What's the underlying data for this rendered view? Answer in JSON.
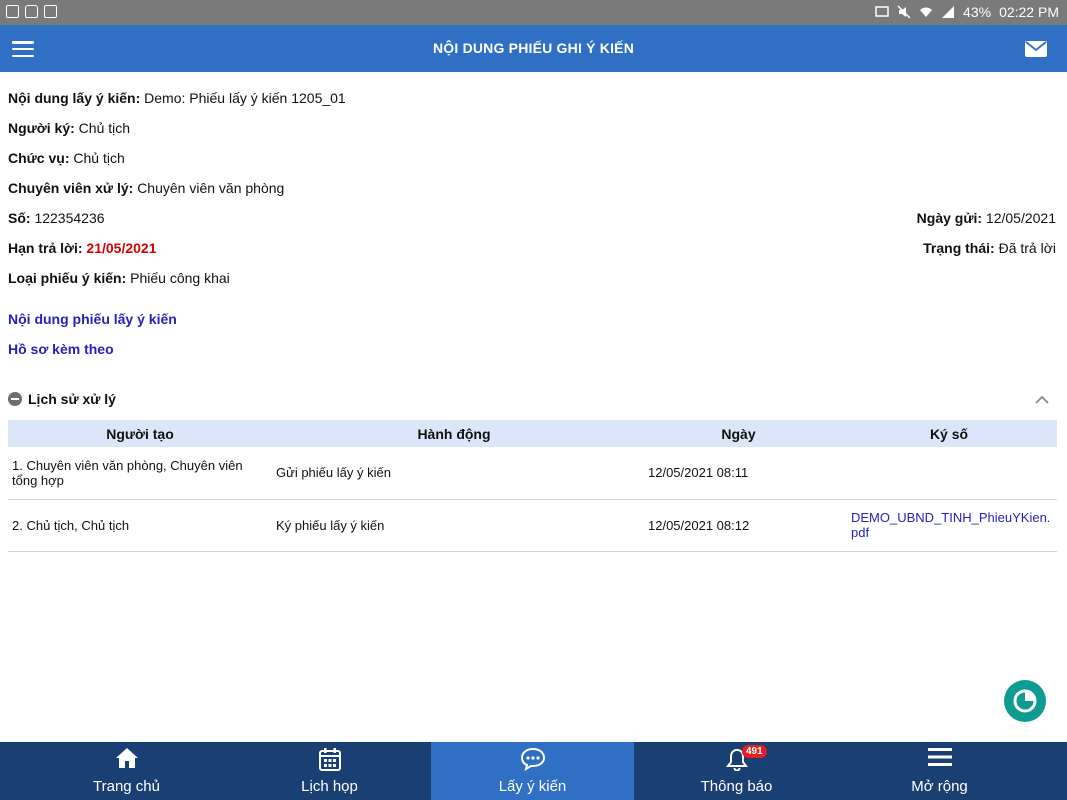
{
  "status_bar": {
    "battery": "43%",
    "time": "02:22 PM"
  },
  "header": {
    "title": "NỘI DUNG PHIẾU GHI Ý KIẾN"
  },
  "info": {
    "noi_dung_label": "Nội dung lấy ý kiến:",
    "noi_dung_value": "Demo: Phiếu lấy ý kiến 1205_01",
    "nguoi_ky_label": "Người ký:",
    "nguoi_ky_value": "Chủ tịch",
    "chuc_vu_label": "Chức vụ:",
    "chuc_vu_value": "Chủ tịch",
    "chuyen_vien_label": "Chuyên viên xử lý:",
    "chuyen_vien_value": "Chuyên viên văn phòng",
    "so_label": "Số:",
    "so_value": "122354236",
    "ngay_gui_label": "Ngày gửi:",
    "ngay_gui_value": "12/05/2021",
    "han_tra_loi_label": "Hạn trả lời:",
    "han_tra_loi_value": "21/05/2021",
    "trang_thai_label": "Trạng thái:",
    "trang_thai_value": "Đã trả lời",
    "loai_phieu_label": "Loại phiếu ý kiến:",
    "loai_phieu_value": "Phiếu công khai"
  },
  "links": {
    "noi_dung_phieu": "Nội dung phiếu lấy ý kiến",
    "ho_so": "Hồ sơ kèm theo"
  },
  "history": {
    "title": "Lịch sử xử lý",
    "columns": [
      "Người tạo",
      "Hành động",
      "Ngày",
      "Ký số"
    ],
    "rows": [
      {
        "nguoi_tao": "1. Chuyên viên văn phòng, Chuyên viên tổng hợp",
        "hanh_dong": "Gửi phiếu lấy ý kiến",
        "ngay": "12/05/2021 08:11",
        "ky_so": ""
      },
      {
        "nguoi_tao": "2. Chủ tịch, Chủ tịch",
        "hanh_dong": "Ký phiếu lấy ý kiến",
        "ngay": "12/05/2021 08:12",
        "ky_so": "DEMO_UBND_TINH_PhieuYKien.pdf"
      }
    ]
  },
  "bottom_nav": {
    "items": [
      {
        "label": "Trang chủ",
        "icon": "home-icon"
      },
      {
        "label": "Lịch họp",
        "icon": "calendar-icon"
      },
      {
        "label": "Lấy ý kiến",
        "icon": "chat-icon"
      },
      {
        "label": "Thông báo",
        "icon": "bell-icon",
        "badge": "491"
      },
      {
        "label": "Mở rộng",
        "icon": "menu-icon"
      }
    ],
    "active_index": 2
  },
  "colors": {
    "primary": "#2f6fc4",
    "nav_dark": "#1a3f73",
    "deadline": "#d40000",
    "link": "#2323b8",
    "fab": "#0e9b92"
  }
}
